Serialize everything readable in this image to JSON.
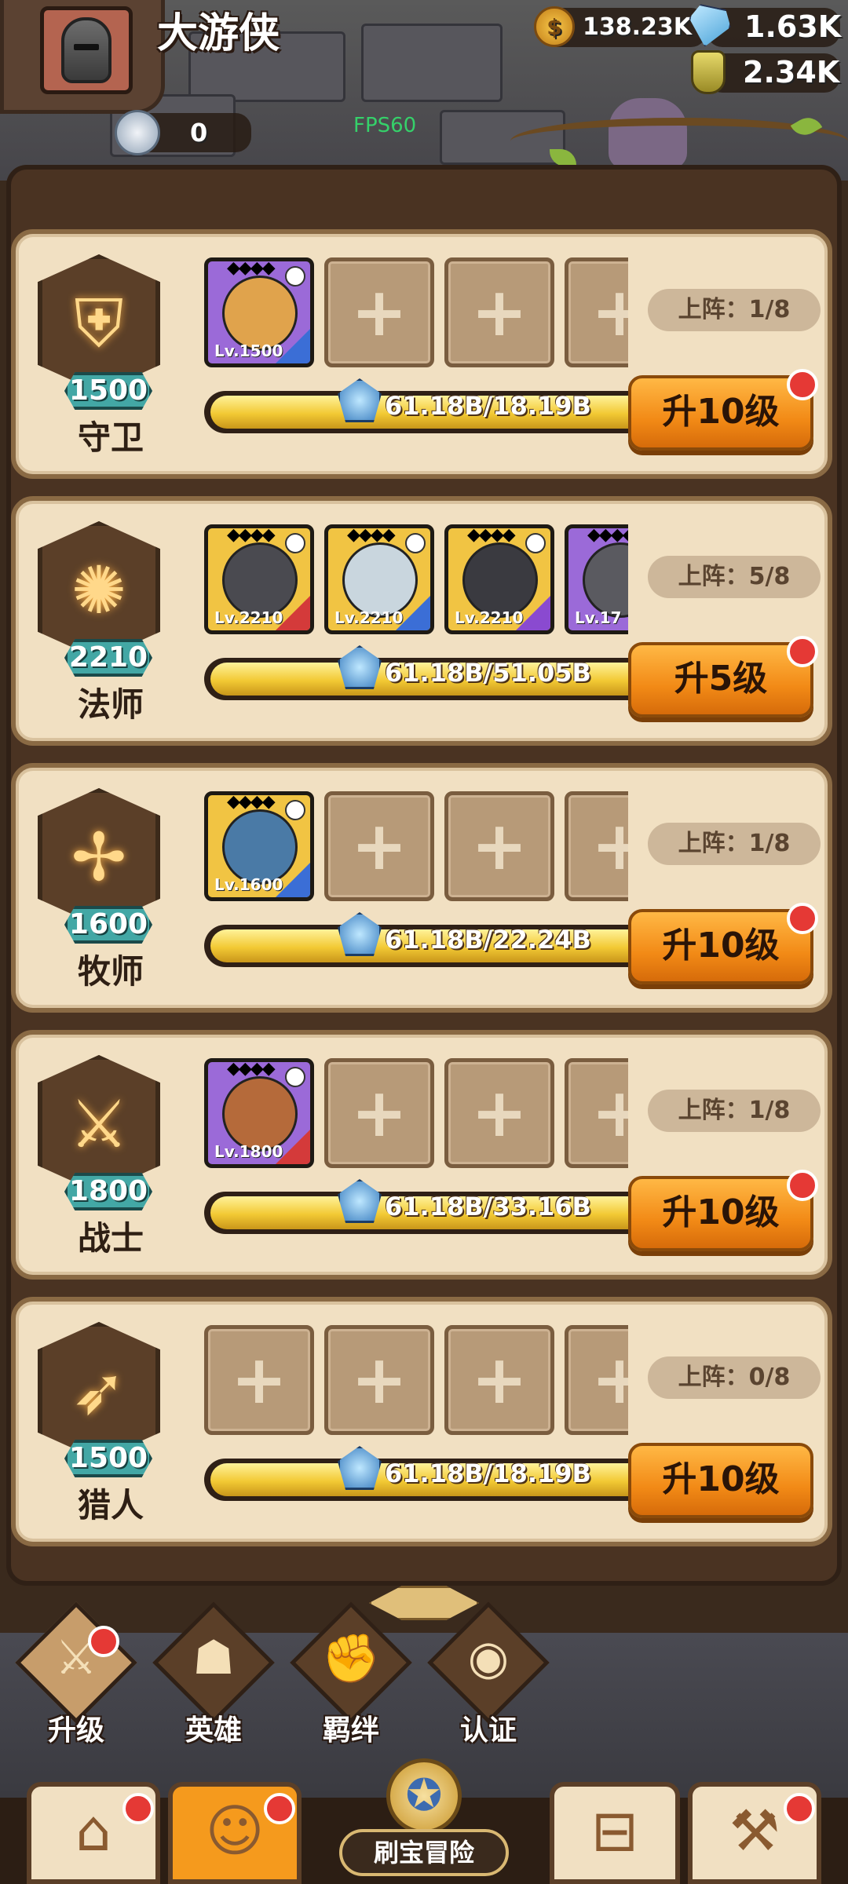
{
  "player": {
    "name": "大游侠"
  },
  "resources": {
    "gold": {
      "value": "138.23K",
      "icon": "coin-icon"
    },
    "diamonds": {
      "value": "1.63K",
      "icon": "gem-icon"
    },
    "potions": {
      "value": "2.34K",
      "icon": "potion-icon"
    },
    "silver": {
      "value": "0",
      "icon": "silver-coin-icon"
    }
  },
  "fps": "FPS60",
  "classes": [
    {
      "name": "守卫",
      "level": "1500",
      "glyph": "⛨",
      "deploy": "上阵：1/8",
      "progress": {
        "text": "61.18B/18.19B",
        "fraction": 1.0
      },
      "upgrade": "升10级",
      "badge": true,
      "heroes": [
        {
          "lv": "Lv.1500",
          "frame": "purple",
          "color": "#e0a34c",
          "corner": "#3b6ed6"
        }
      ]
    },
    {
      "name": "法师",
      "level": "2210",
      "glyph": "✺",
      "deploy": "上阵：5/8",
      "progress": {
        "text": "61.18B/51.05B",
        "fraction": 1.0
      },
      "upgrade": "升5级",
      "badge": true,
      "heroes": [
        {
          "lv": "Lv.2210",
          "frame": "gold",
          "color": "#4a4a50",
          "corner": "#d43a3a"
        },
        {
          "lv": "Lv.2210",
          "frame": "gold",
          "color": "#c9d6de",
          "corner": "#3b6ed6"
        },
        {
          "lv": "Lv.2210",
          "frame": "gold",
          "color": "#3a3a40",
          "corner": "#8a4ad0"
        },
        {
          "lv": "Lv.17",
          "frame": "purple",
          "color": "#5a5a60",
          "corner": "#3b6ed6"
        }
      ]
    },
    {
      "name": "牧师",
      "level": "1600",
      "glyph": "✢",
      "deploy": "上阵：1/8",
      "progress": {
        "text": "61.18B/22.24B",
        "fraction": 1.0
      },
      "upgrade": "升10级",
      "badge": true,
      "heroes": [
        {
          "lv": "Lv.1600",
          "frame": "gold",
          "color": "#4a7aa6",
          "corner": "#3b6ed6"
        }
      ]
    },
    {
      "name": "战士",
      "level": "1800",
      "glyph": "⚔",
      "deploy": "上阵：1/8",
      "progress": {
        "text": "61.18B/33.16B",
        "fraction": 1.0
      },
      "upgrade": "升10级",
      "badge": true,
      "heroes": [
        {
          "lv": "Lv.1800",
          "frame": "purple",
          "color": "#b56a3a",
          "corner": "#d43a3a"
        }
      ]
    },
    {
      "name": "猎人",
      "level": "1500",
      "glyph": "➶",
      "deploy": "上阵：0/8",
      "progress": {
        "text": "61.18B/18.19B",
        "fraction": 1.0
      },
      "upgrade": "升10级",
      "badge": false,
      "heroes": []
    }
  ],
  "subnav": [
    {
      "label": "升级",
      "glyph": "⚔",
      "active": true,
      "badge": true
    },
    {
      "label": "英雄",
      "glyph": "☗",
      "active": false,
      "badge": false
    },
    {
      "label": "羁绊",
      "glyph": "✊",
      "active": false,
      "badge": false
    },
    {
      "label": "认证",
      "glyph": "◉",
      "active": false,
      "badge": false
    }
  ],
  "bottom_tabs": [
    {
      "name": "shop",
      "glyph": "⌂",
      "badge": true,
      "active": false
    },
    {
      "name": "heroes",
      "glyph": "☺",
      "badge": true,
      "active": true
    },
    {
      "name": "adventure",
      "label": "刷宝冒险",
      "glyph": "✪"
    },
    {
      "name": "backpack",
      "glyph": "⊟",
      "badge": false,
      "active": false
    },
    {
      "name": "forge",
      "glyph": "⚒",
      "badge": true,
      "active": false
    }
  ],
  "colors": {
    "panel": "#f1e0c2",
    "button": "#f28a16",
    "badge": "#e53935",
    "level_tag": "#43a7a5"
  }
}
